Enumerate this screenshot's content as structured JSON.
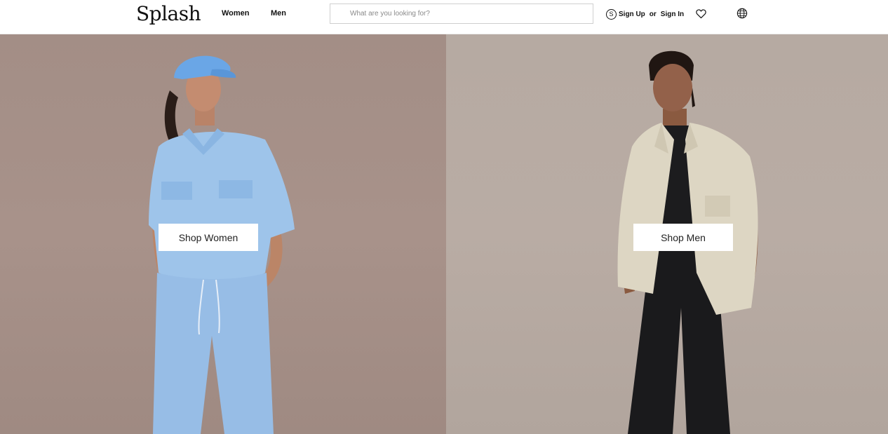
{
  "header": {
    "logo": "Splash",
    "nav": [
      {
        "label": "Women"
      },
      {
        "label": "Men"
      }
    ],
    "search": {
      "placeholder": "What are you looking for?"
    },
    "account": {
      "icon_letter": "S",
      "sign_up": "Sign Up",
      "or": "or",
      "sign_in": "Sign In"
    },
    "icons": [
      "wishlist-heart-icon",
      "globe-icon"
    ]
  },
  "hero": {
    "women": {
      "button_label": "Shop Women"
    },
    "men": {
      "button_label": "Shop Men"
    }
  },
  "colors": {
    "women_backdrop": "#a8928a",
    "men_backdrop": "#b9aca4",
    "women_outfit": "#9ec4ea",
    "men_shirt": "#ddd6c3",
    "men_trousers": "#1a1a1c"
  }
}
